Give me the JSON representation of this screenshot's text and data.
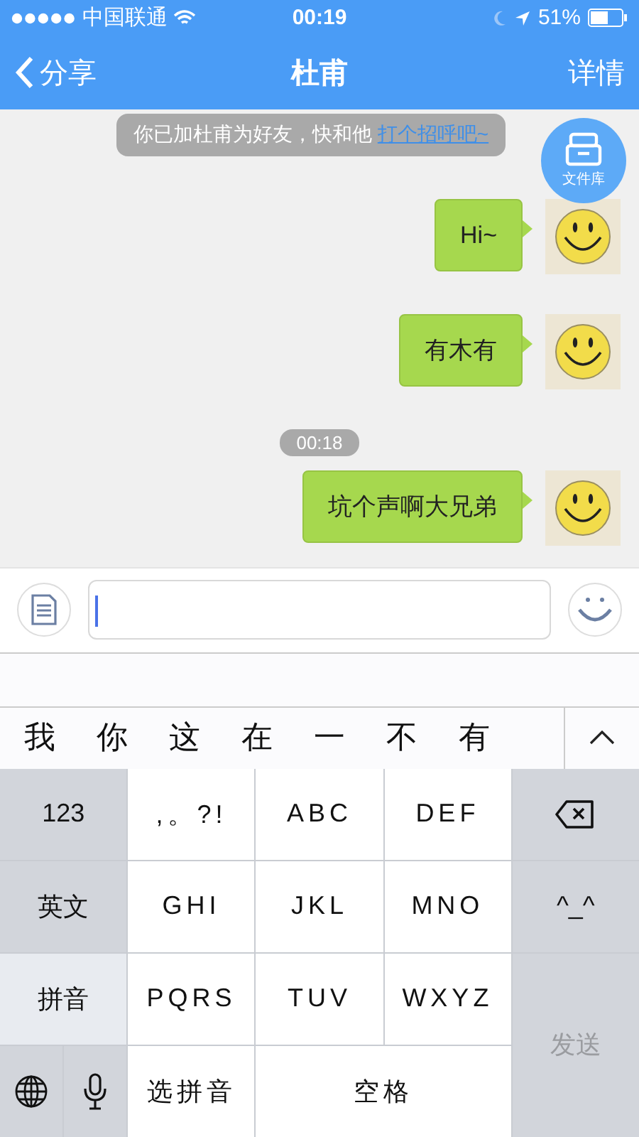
{
  "status_bar": {
    "carrier": "中国联通",
    "time": "00:19",
    "battery": "51%"
  },
  "nav": {
    "back": "分享",
    "title": "杜甫",
    "action": "详情"
  },
  "notice": {
    "text": "你已加杜甫为好友，快和他 ",
    "link": "打个招呼吧~"
  },
  "file_button": {
    "label": "文件库"
  },
  "messages": [
    {
      "kind": "message",
      "text": "Hi~"
    },
    {
      "kind": "message",
      "text": "有木有"
    },
    {
      "kind": "time",
      "text": "00:18"
    },
    {
      "kind": "message",
      "text": "坑个声啊大兄弟"
    }
  ],
  "candidates": [
    "我",
    "你",
    "这",
    "在",
    "一",
    "不",
    "有"
  ],
  "keyboard": [
    {
      "kind": "function",
      "label": "123",
      "selected": false,
      "disabled": false
    },
    {
      "kind": "letter",
      "label": ",。?!",
      "selected": false,
      "disabled": false
    },
    {
      "kind": "letter",
      "label": "ABC",
      "selected": false,
      "disabled": false
    },
    {
      "kind": "letter",
      "label": "DEF",
      "selected": false,
      "disabled": false
    },
    {
      "kind": "delete",
      "selected": false,
      "disabled": false
    },
    {
      "kind": "function",
      "label": "英文",
      "selected": false,
      "disabled": false
    },
    {
      "kind": "letter",
      "label": "GHI",
      "selected": false,
      "disabled": false
    },
    {
      "kind": "letter",
      "label": "JKL",
      "selected": false,
      "disabled": false
    },
    {
      "kind": "letter",
      "label": "MNO",
      "selected": false,
      "disabled": false
    },
    {
      "kind": "function",
      "label": "^_^",
      "selected": false,
      "disabled": false
    },
    {
      "kind": "function",
      "label": "拼音",
      "selected": true,
      "disabled": false
    },
    {
      "kind": "letter",
      "label": "PQRS",
      "selected": false,
      "disabled": false
    },
    {
      "kind": "letter",
      "label": "TUV",
      "selected": false,
      "disabled": false
    },
    {
      "kind": "letter",
      "label": "WXYZ",
      "selected": false,
      "disabled": false
    },
    {
      "kind": "function",
      "label": "发送",
      "selected": false,
      "disabled": true
    },
    {
      "kind": "globe",
      "selected": false,
      "disabled": false
    },
    {
      "kind": "mic",
      "selected": false,
      "disabled": false
    },
    {
      "kind": "letter",
      "label": "选拼音",
      "selected": false,
      "disabled": false
    },
    {
      "kind": "letter",
      "label": "空格",
      "selected": false,
      "disabled": false
    }
  ]
}
